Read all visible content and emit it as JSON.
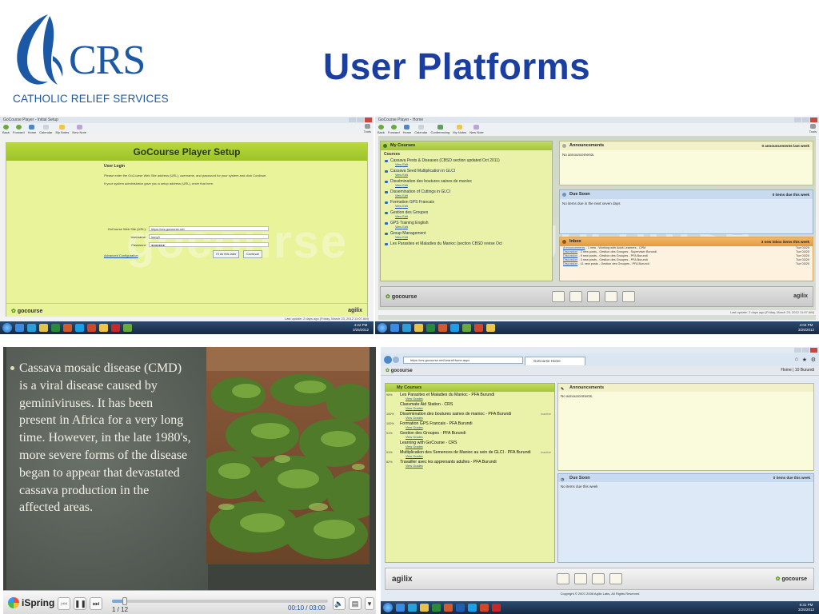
{
  "header": {
    "logo_text": "CRS",
    "logo_subtitle": "CATHOLIC RELIEF SERVICES",
    "title": "User Platforms"
  },
  "colors": {
    "title_blue": "#1b3fa0",
    "logo_blue": "#1b58a6",
    "gocourse_green": "#e8f39a",
    "taskbar": "#152a45"
  },
  "shot1": {
    "window_title": "GoCourse Player - Initial Setup",
    "toolbar": [
      "Back",
      "Forward",
      "Home",
      "Calendar",
      "My Notes",
      "New Note"
    ],
    "tools_label": "Tools",
    "heading": "GoCourse Player Setup",
    "login_heading": "User Login",
    "instruction1": "Please enter the GoCourse Web Site address (URL), username, and password for your system and click Continue.",
    "instruction2": "If your system administrator gave you a setup address (URL), enter that here.",
    "fields": [
      {
        "label": "GoCourse Web Site (URL):",
        "value": "https://crs.gocourse.net"
      },
      {
        "label": "Username:",
        "value": "lomy3"
      },
      {
        "label": "Password:",
        "value": "●●●●●●●"
      }
    ],
    "advanced_link": "Advanced Configuration",
    "later_button": "I'll do this later",
    "continue_button": "Continue",
    "logo": "gocourse",
    "brand": "agilix",
    "status": "Last update: 2 days ago (Friday, March 23, 2012 11:07 AM)",
    "clock_time": "4:22 PM",
    "clock_date": "3/25/2012"
  },
  "shot2": {
    "window_title": "GoCourse Player - Home",
    "toolbar": [
      "Back",
      "Forward",
      "Home",
      "Calendar",
      "Conferencing",
      "My Notes",
      "New Note"
    ],
    "tools_label": "Tools",
    "my_courses": "My Courses",
    "courses_label": "Courses",
    "courses": [
      "Cassava Pests & Diseases (CBSD section updated Oct 2011)",
      "Cassava Seed Multiplication in GLCI",
      "Dissémination des boutures saines de manioc",
      "Dissemination of Cuttings in GLCI",
      "Formation GPS Francais",
      "Gestion des Groupes",
      "GPS Training English",
      "Group Management",
      "Les Parasites et Maladies du Manioc (section CBSD revise Oct"
    ],
    "view_label": "View",
    "edit_label": "Edit",
    "announcements": "Announcements",
    "announcements_count": "0 announcements last week",
    "no_announcements": "No announcements.",
    "due_soon": "Due Soon",
    "due_count": "0 items due this week",
    "due_none": "No items due in the next seven days",
    "inbox": "Inbox",
    "inbox_count": "3 new inbox items this week",
    "inbox_items": [
      {
        "kind": "Announcements",
        "text": " - 1 new - Working with Adult Learners - CPM",
        "date": "Tue 03/20"
      },
      {
        "kind": "Discussion",
        "text": " - 2 new posts - Gestion des Groupes - Superviser Burundi",
        "date": "Tue 03/20"
      },
      {
        "kind": "Discussion",
        "text": " - 9 new posts - Gestion des Groupes - PFA Burundi",
        "date": "Tue 03/20"
      },
      {
        "kind": "Discussion",
        "text": " - 3 new posts - Gestion des Groupes - PFA Burundi",
        "date": "Tue 03/20"
      },
      {
        "kind": "Discussion",
        "text": " - 11 new posts - Gestion des Groupes - PFA Burundi",
        "date": "Tue 03/20"
      }
    ],
    "logo": "gocourse",
    "brand": "agilix",
    "status": "Last update: 2 days ago (Friday, March 23, 2012 11:07 AM)",
    "clock_time": "4:04 PM",
    "clock_date": "3/25/2012"
  },
  "shot3": {
    "bullet": "Cassava mosaic disease (CMD) is a viral disease caused by geminiviruses.  It has been present in Africa for a very long time. However, in the late 1980's, more severe forms of the disease began to appear that devastated cassava production in the affected areas.",
    "player_name": "iSpring",
    "slide_counter": "1 / 12",
    "time": "00:10 / 03:00",
    "progress": 0.06
  },
  "shot4": {
    "url": "https://crs.gocourse.net/Learn/Home.aspx",
    "tab": "GoCourse Home",
    "logo": "gocourse",
    "nav": "Home | 10 Burundi",
    "my_courses": "My Courses",
    "courses": [
      {
        "pct": "98%",
        "name": "Les Parasites et Maladies du Manioc - PFA Burundi",
        "inactive": ""
      },
      {
        "pct": "",
        "name": "Classmate Aid Station - CRS",
        "inactive": "Inactive"
      },
      {
        "pct": "100%",
        "name": "Dissémination des boutures saines de manioc - PFA Burundi",
        "inactive": ""
      },
      {
        "pct": "100%",
        "name": "Formation GPS Francais - PFA Burundi",
        "inactive": ""
      },
      {
        "pct": "91%",
        "name": "Gestion des Groupes - PFA Burundi",
        "inactive": ""
      },
      {
        "pct": "",
        "name": "Learning with GoCourse - CRS",
        "inactive": "Inactive"
      },
      {
        "pct": "91%",
        "name": "Multiplication des Semences de Manioc au sein de GLCI - PFA Burundi",
        "inactive": ""
      },
      {
        "pct": "82%",
        "name": "Travailler avec les apprenants adultes - PFA Burundi",
        "inactive": ""
      }
    ],
    "view_label": "View",
    "grades_label": "Grades",
    "announcements": "Announcements",
    "no_announcements": "No announcements.",
    "due_soon": "Due Soon",
    "due_count": "0 items due this week",
    "due_none": "No items due this week",
    "brand": "agilix",
    "copyright": "Copyright © 2007-2008 Agilix Labs, All Rights Reserved",
    "clock_time": "6:31 PM",
    "clock_date": "3/25/2012"
  }
}
